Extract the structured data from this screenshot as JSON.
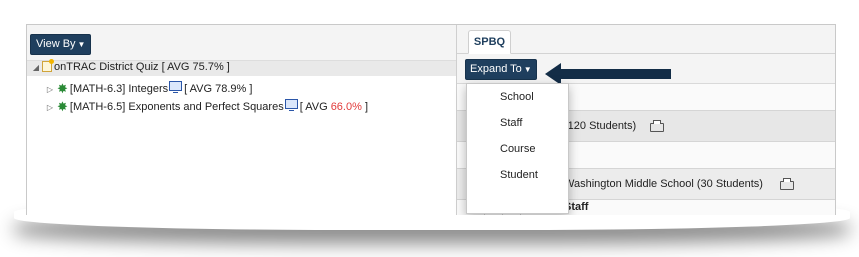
{
  "left_panel": {
    "view_by_label": "View By",
    "tree": {
      "root": {
        "text": "onTRAC District Quiz [ AVG 75.7% ]"
      },
      "children": [
        {
          "code": "[MATH-6.3] Integers",
          "avg_prefix": "[ AVG ",
          "avg_value": "78.9%",
          "avg_suffix": " ]",
          "avg_color": "#222222"
        },
        {
          "code": "[MATH-6.5] Exponents and Perfect Squares",
          "avg_prefix": "[ AVG ",
          "avg_value": "66.0%",
          "avg_suffix": " ]",
          "avg_color": "#e23b3b"
        }
      ]
    }
  },
  "right_panel": {
    "tab_label": "SPBQ",
    "expand_label": "Expand To",
    "rows": {
      "district": "(120 Students)",
      "school": "Washington Middle School (30 Students)",
      "staff_header": "Staff"
    },
    "dropdown_items": [
      "School",
      "Staff",
      "Course",
      "Student"
    ]
  },
  "colors": {
    "button_dark": "#1f3f5e",
    "pointer": "#132d47",
    "low_avg": "#e23b3b"
  }
}
